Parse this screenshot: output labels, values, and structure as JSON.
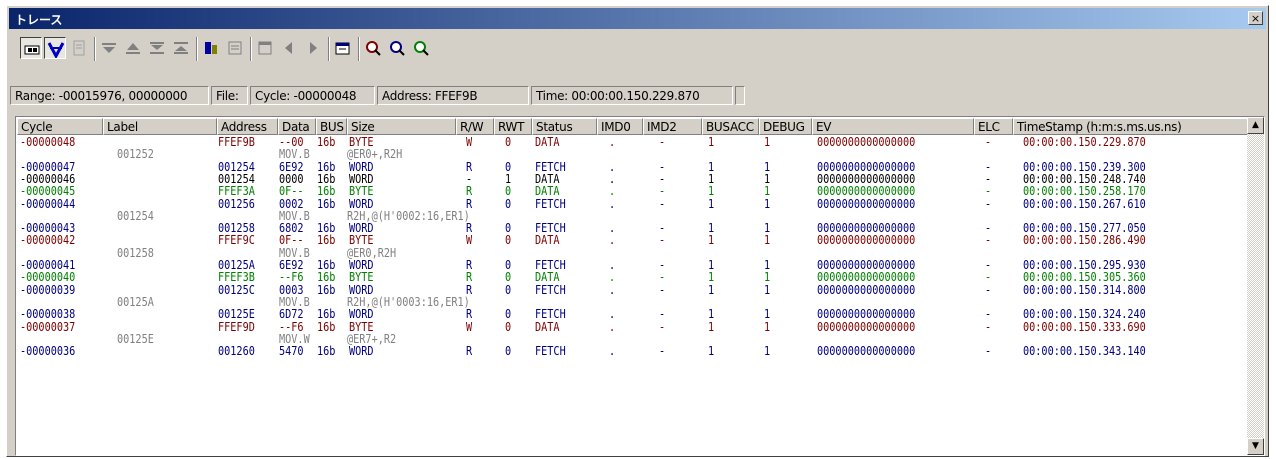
{
  "window": {
    "title": "トレース",
    "close_glyph": "×"
  },
  "toolbar": {
    "buttons": [
      {
        "name": "trace-acquire-icon",
        "pressed": true
      },
      {
        "name": "trace-stop-icon",
        "pressed": true
      },
      {
        "name": "clear-icon",
        "pressed": false
      },
      {
        "name": "scroll-top-icon",
        "pressed": false
      },
      {
        "name": "scroll-bottom-icon",
        "pressed": false
      },
      {
        "name": "double-down-icon",
        "pressed": false
      },
      {
        "name": "double-up-icon",
        "pressed": false
      },
      {
        "name": "source-view-icon",
        "pressed": false
      },
      {
        "name": "mixed-view-icon",
        "pressed": false
      },
      {
        "name": "window-view-icon",
        "pressed": false
      },
      {
        "name": "prev-icon",
        "pressed": false
      },
      {
        "name": "next-icon",
        "pressed": false
      },
      {
        "name": "properties-icon",
        "pressed": false
      },
      {
        "name": "find-icon",
        "pressed": false
      },
      {
        "name": "find-next-icon",
        "pressed": false
      },
      {
        "name": "find-prev-icon",
        "pressed": false
      }
    ]
  },
  "status": {
    "range": "Range: -00015976, 00000000",
    "file": "File:",
    "cycle": "Cycle: -00000048",
    "address": "Address: FFEF9B",
    "time": "Time: 00:00:00.150.229.870"
  },
  "columns": [
    "Cycle",
    "Label",
    "Address",
    "Data",
    "BUS",
    "Size",
    "R/W",
    "RWT",
    "Status",
    "IMD0",
    "IMD2",
    "BUSACC",
    "DEBUG",
    "EV",
    "ELC",
    "TimeStamp (h:m:s.ms.us.ns)"
  ],
  "colors": {
    "fetch": "#000080",
    "read": "#008000",
    "write": "#800000",
    "data": "#000000",
    "source": "#808080"
  },
  "rows": [
    {
      "type": "write",
      "cycle": "-00000048",
      "label": "",
      "address": "FFEF9B",
      "data": "--00",
      "bus": "16b",
      "size": "BYTE",
      "rw": "W",
      "rwt": "0",
      "status": "DATA",
      "imd0": ".",
      "imd2": "-",
      "busacc": "1",
      "debug": "1",
      "ev": "0000000000000000",
      "elc": "-",
      "ts": "00:00:00.150.229.870"
    },
    {
      "type": "source",
      "label": "001252",
      "mnemonic": "MOV.B",
      "operand": "@ER0+,R2H"
    },
    {
      "type": "fetch",
      "cycle": "-00000047",
      "label": "",
      "address": "001254",
      "data": "6E92",
      "bus": "16b",
      "size": "WORD",
      "rw": "R",
      "rwt": "0",
      "status": "FETCH",
      "imd0": ".",
      "imd2": "-",
      "busacc": "1",
      "debug": "1",
      "ev": "0000000000000000",
      "elc": "-",
      "ts": "00:00:00.150.239.300"
    },
    {
      "type": "data",
      "cycle": "-00000046",
      "label": "",
      "address": "001254",
      "data": "0000",
      "bus": "16b",
      "size": "WORD",
      "rw": "-",
      "rwt": "1",
      "status": "DATA",
      "imd0": ".",
      "imd2": "-",
      "busacc": "1",
      "debug": "1",
      "ev": "0000000000000000",
      "elc": "-",
      "ts": "00:00:00.150.248.740"
    },
    {
      "type": "read",
      "cycle": "-00000045",
      "label": "",
      "address": "FFEF3A",
      "data": "0F--",
      "bus": "16b",
      "size": "BYTE",
      "rw": "R",
      "rwt": "0",
      "status": "DATA",
      "imd0": ".",
      "imd2": "-",
      "busacc": "1",
      "debug": "1",
      "ev": "0000000000000000",
      "elc": "-",
      "ts": "00:00:00.150.258.170"
    },
    {
      "type": "fetch",
      "cycle": "-00000044",
      "label": "",
      "address": "001256",
      "data": "0002",
      "bus": "16b",
      "size": "WORD",
      "rw": "R",
      "rwt": "0",
      "status": "FETCH",
      "imd0": ".",
      "imd2": "-",
      "busacc": "1",
      "debug": "1",
      "ev": "0000000000000000",
      "elc": "-",
      "ts": "00:00:00.150.267.610"
    },
    {
      "type": "source",
      "label": "001254",
      "mnemonic": "MOV.B",
      "operand": "R2H,@(H'0002:16,ER1)"
    },
    {
      "type": "fetch",
      "cycle": "-00000043",
      "label": "",
      "address": "001258",
      "data": "6802",
      "bus": "16b",
      "size": "WORD",
      "rw": "R",
      "rwt": "0",
      "status": "FETCH",
      "imd0": ".",
      "imd2": "-",
      "busacc": "1",
      "debug": "1",
      "ev": "0000000000000000",
      "elc": "-",
      "ts": "00:00:00.150.277.050"
    },
    {
      "type": "write",
      "cycle": "-00000042",
      "label": "",
      "address": "FFEF9C",
      "data": "0F--",
      "bus": "16b",
      "size": "BYTE",
      "rw": "W",
      "rwt": "0",
      "status": "DATA",
      "imd0": ".",
      "imd2": "-",
      "busacc": "1",
      "debug": "1",
      "ev": "0000000000000000",
      "elc": "-",
      "ts": "00:00:00.150.286.490"
    },
    {
      "type": "source",
      "label": "001258",
      "mnemonic": "MOV.B",
      "operand": "@ER0,R2H"
    },
    {
      "type": "fetch",
      "cycle": "-00000041",
      "label": "",
      "address": "00125A",
      "data": "6E92",
      "bus": "16b",
      "size": "WORD",
      "rw": "R",
      "rwt": "0",
      "status": "FETCH",
      "imd0": ".",
      "imd2": "-",
      "busacc": "1",
      "debug": "1",
      "ev": "0000000000000000",
      "elc": "-",
      "ts": "00:00:00.150.295.930"
    },
    {
      "type": "read",
      "cycle": "-00000040",
      "label": "",
      "address": "FFEF3B",
      "data": "--F6",
      "bus": "16b",
      "size": "BYTE",
      "rw": "R",
      "rwt": "0",
      "status": "DATA",
      "imd0": ".",
      "imd2": "-",
      "busacc": "1",
      "debug": "1",
      "ev": "0000000000000000",
      "elc": "-",
      "ts": "00:00:00.150.305.360"
    },
    {
      "type": "fetch",
      "cycle": "-00000039",
      "label": "",
      "address": "00125C",
      "data": "0003",
      "bus": "16b",
      "size": "WORD",
      "rw": "R",
      "rwt": "0",
      "status": "FETCH",
      "imd0": ".",
      "imd2": "-",
      "busacc": "1",
      "debug": "1",
      "ev": "0000000000000000",
      "elc": "-",
      "ts": "00:00:00.150.314.800"
    },
    {
      "type": "source",
      "label": "00125A",
      "mnemonic": "MOV.B",
      "operand": "R2H,@(H'0003:16,ER1)"
    },
    {
      "type": "fetch",
      "cycle": "-00000038",
      "label": "",
      "address": "00125E",
      "data": "6D72",
      "bus": "16b",
      "size": "WORD",
      "rw": "R",
      "rwt": "0",
      "status": "FETCH",
      "imd0": ".",
      "imd2": "-",
      "busacc": "1",
      "debug": "1",
      "ev": "0000000000000000",
      "elc": "-",
      "ts": "00:00:00.150.324.240"
    },
    {
      "type": "write",
      "cycle": "-00000037",
      "label": "",
      "address": "FFEF9D",
      "data": "--F6",
      "bus": "16b",
      "size": "BYTE",
      "rw": "W",
      "rwt": "0",
      "status": "DATA",
      "imd0": ".",
      "imd2": "-",
      "busacc": "1",
      "debug": "1",
      "ev": "0000000000000000",
      "elc": "-",
      "ts": "00:00:00.150.333.690"
    },
    {
      "type": "source",
      "label": "00125E",
      "mnemonic": "MOV.W",
      "operand": "@ER7+,R2"
    },
    {
      "type": "fetch",
      "cycle": "-00000036",
      "label": "",
      "address": "001260",
      "data": "5470",
      "bus": "16b",
      "size": "WORD",
      "rw": "R",
      "rwt": "0",
      "status": "FETCH",
      "imd0": ".",
      "imd2": "-",
      "busacc": "1",
      "debug": "1",
      "ev": "0000000000000000",
      "elc": "-",
      "ts": "00:00:00.150.343.140"
    }
  ]
}
